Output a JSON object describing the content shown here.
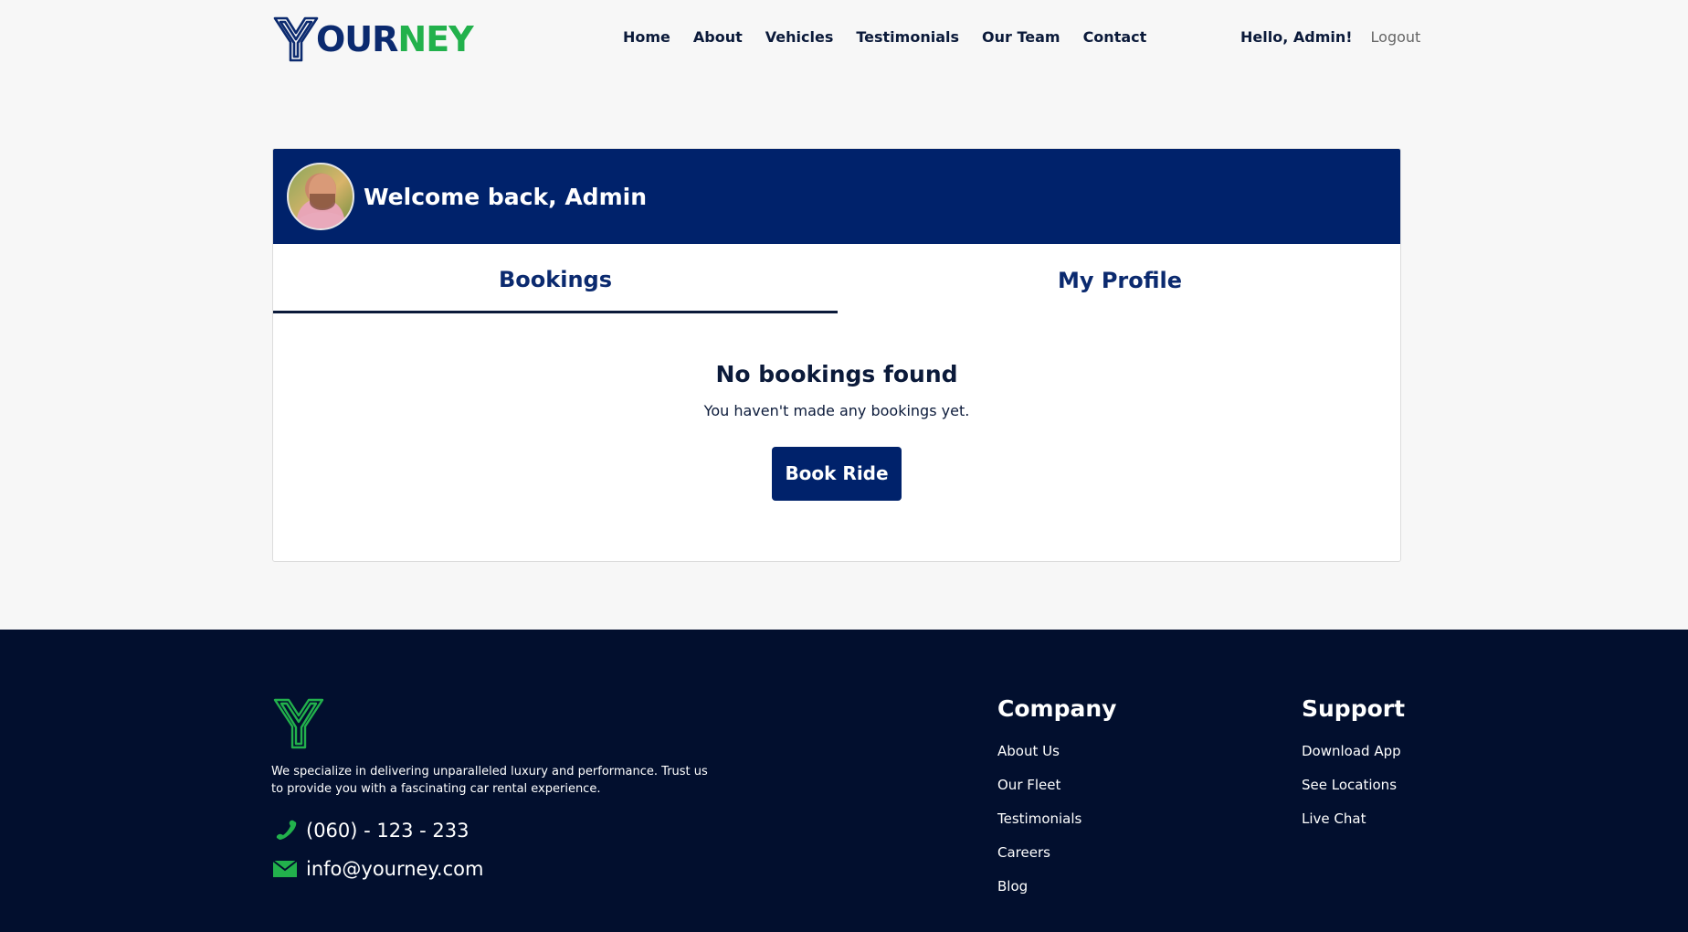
{
  "brand": {
    "logo_text_part1": "OUR",
    "logo_text_part2": "NEY",
    "primary_color": "#00226b",
    "accent_color": "#22b14c",
    "footer_bg": "#020f2e"
  },
  "nav": {
    "items": [
      {
        "label": "Home"
      },
      {
        "label": "About"
      },
      {
        "label": "Vehicles"
      },
      {
        "label": "Testimonials"
      },
      {
        "label": "Our Team"
      },
      {
        "label": "Contact"
      }
    ],
    "greeting": "Hello, Admin!",
    "logout_label": "Logout"
  },
  "dashboard": {
    "avatar_icon": "user-avatar",
    "welcome": "Welcome back, Admin",
    "tabs": [
      {
        "label": "Bookings",
        "active": true
      },
      {
        "label": "My Profile",
        "active": false
      }
    ],
    "empty_title": "No bookings found",
    "empty_subtitle": "You haven't made any bookings yet.",
    "book_button": "Book Ride"
  },
  "footer": {
    "description": "We specialize in delivering unparalleled luxury and performance. Trust us to provide you with a fascinating car rental experience.",
    "phone": "(060) - 123 - 233",
    "email": "info@yourney.com",
    "company": {
      "heading": "Company",
      "links": [
        "About Us",
        "Our Fleet",
        "Testimonials",
        "Careers",
        "Blog"
      ]
    },
    "support": {
      "heading": "Support",
      "links": [
        "Download App",
        "See Locations",
        "Live Chat"
      ]
    }
  }
}
